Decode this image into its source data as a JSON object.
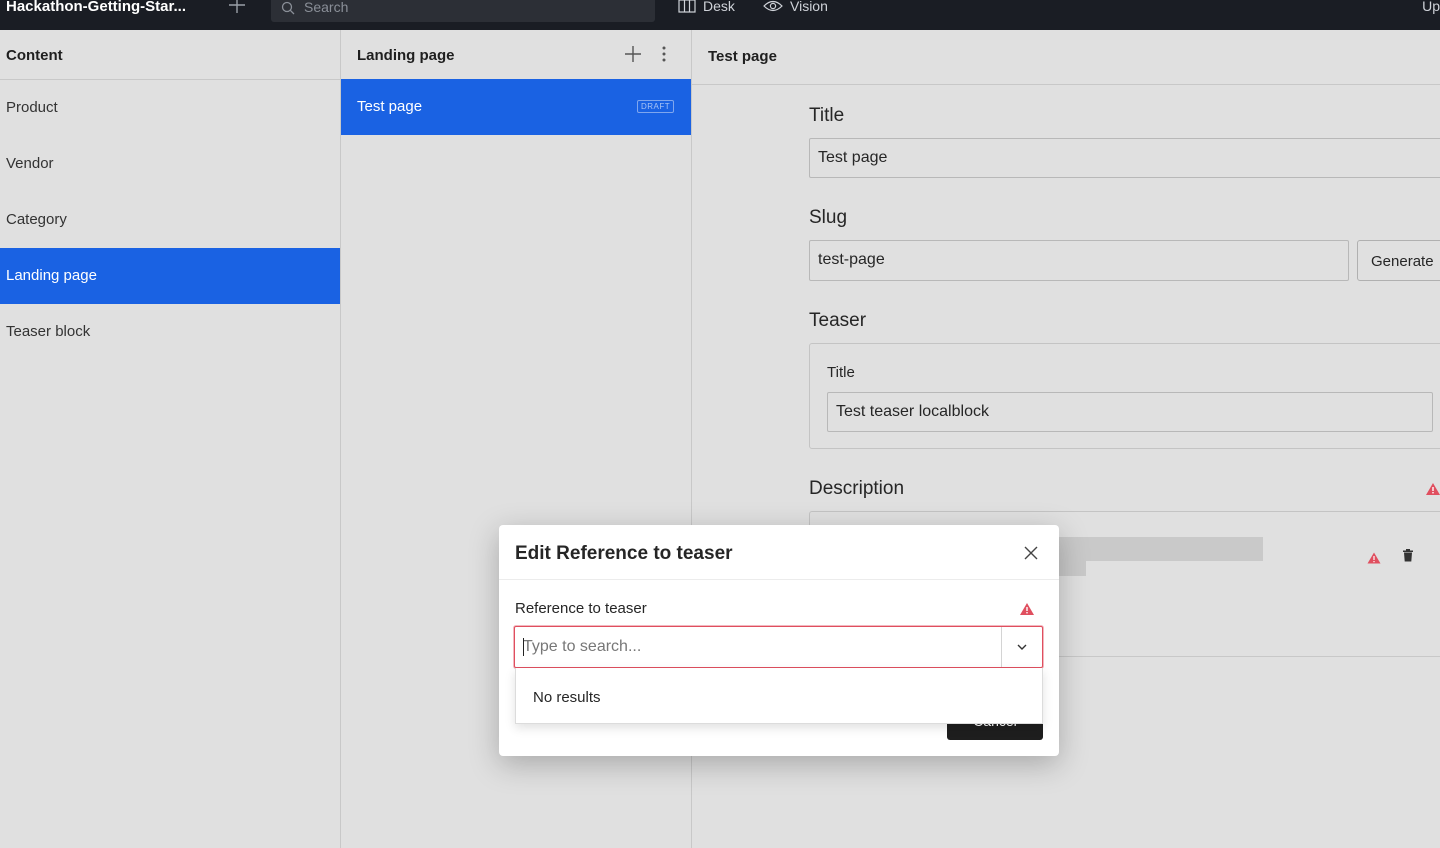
{
  "topbar": {
    "project_name": "Hackathon-Getting-Star...",
    "search_placeholder": "Search",
    "tools": [
      {
        "label": "Desk",
        "icon": "desk-icon"
      },
      {
        "label": "Vision",
        "icon": "eye-icon"
      }
    ],
    "right_text": "Up"
  },
  "content_pane": {
    "title": "Content",
    "items": [
      {
        "label": "Product",
        "active": false
      },
      {
        "label": "Vendor",
        "active": false
      },
      {
        "label": "Category",
        "active": false
      },
      {
        "label": "Landing page",
        "active": true
      },
      {
        "label": "Teaser block",
        "active": false
      }
    ]
  },
  "list_pane": {
    "title": "Landing page",
    "documents": [
      {
        "title": "Test page",
        "status": "DRAFT"
      }
    ]
  },
  "editor": {
    "title": "Test page",
    "fields": {
      "title_label": "Title",
      "title_value": "Test page",
      "slug_label": "Slug",
      "slug_value": "test-page",
      "generate_label": "Generate",
      "teaser_label": "Teaser",
      "teaser_title_label": "Title",
      "teaser_title_value": "Test teaser localblock",
      "description_label": "Description"
    }
  },
  "modal": {
    "title": "Edit Reference to teaser",
    "field_label": "Reference to teaser",
    "search_placeholder": "Type to search...",
    "no_results": "No results",
    "cancel_label": "Cancel"
  },
  "colors": {
    "accent": "#1a62e3",
    "topbar": "#1a1d24",
    "warning": "#e04f5f",
    "background": "#e0e0e0"
  }
}
